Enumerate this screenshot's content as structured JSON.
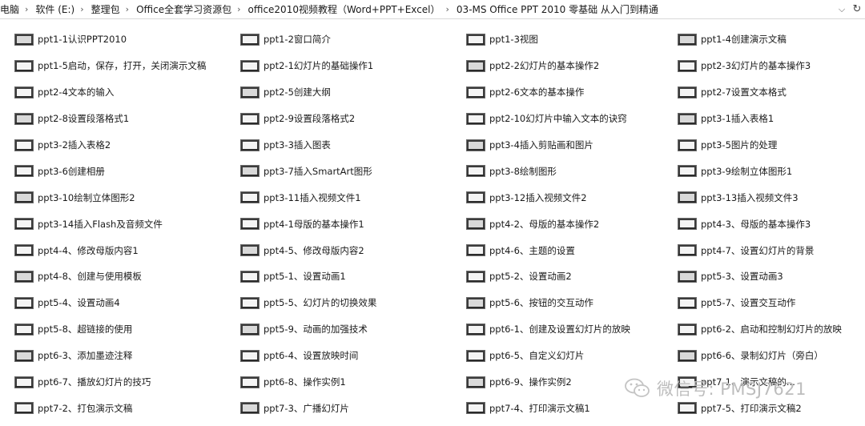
{
  "breadcrumb": [
    "电脑",
    "软件 (E:)",
    "整理包",
    "Office全套学习资源包",
    "office2010视频教程（Word+PPT+Excel）",
    "03-MS Office PPT 2010 零基础 从入门到精通"
  ],
  "separator": "›",
  "address_dropdown": "⌵",
  "refresh": "↻",
  "files": [
    {
      "name": "ppt1-1认识PPT2010"
    },
    {
      "name": "ppt1-2窗口简介"
    },
    {
      "name": "ppt1-3视图"
    },
    {
      "name": "ppt1-4创建演示文稿"
    },
    {
      "name": "ppt1-5启动，保存，打开，关闭演示文稿"
    },
    {
      "name": "ppt2-1幻灯片的基础操作1"
    },
    {
      "name": "ppt2-2幻灯片的基本操作2"
    },
    {
      "name": "ppt2-3幻灯片的基本操作3"
    },
    {
      "name": "ppt2-4文本的输入"
    },
    {
      "name": "ppt2-5创建大纲"
    },
    {
      "name": "ppt2-6文本的基本操作"
    },
    {
      "name": "ppt2-7设置文本格式"
    },
    {
      "name": "ppt2-8设置段落格式1"
    },
    {
      "name": "ppt2-9设置段落格式2"
    },
    {
      "name": "ppt2-10幻灯片中输入文本的诀窍"
    },
    {
      "name": "ppt3-1插入表格1"
    },
    {
      "name": "ppt3-2插入表格2"
    },
    {
      "name": "ppt3-3插入图表"
    },
    {
      "name": "ppt3-4插入剪贴画和图片"
    },
    {
      "name": "ppt3-5图片的处理"
    },
    {
      "name": "ppt3-6创建相册"
    },
    {
      "name": "ppt3-7插入SmartArt图形"
    },
    {
      "name": "ppt3-8绘制图形"
    },
    {
      "name": "ppt3-9绘制立体图形1"
    },
    {
      "name": "ppt3-10绘制立体图形2"
    },
    {
      "name": "ppt3-11插入视频文件1"
    },
    {
      "name": "ppt3-12插入视频文件2"
    },
    {
      "name": "ppt3-13插入视频文件3"
    },
    {
      "name": "ppt3-14插入Flash及音频文件"
    },
    {
      "name": "ppt4-1母版的基本操作1"
    },
    {
      "name": "ppt4-2、母版的基本操作2"
    },
    {
      "name": "ppt4-3、母版的基本操作3"
    },
    {
      "name": "ppt4-4、修改母版内容1"
    },
    {
      "name": "ppt4-5、修改母版内容2"
    },
    {
      "name": "ppt4-6、主题的设置"
    },
    {
      "name": "ppt4-7、设置幻灯片的背景"
    },
    {
      "name": "ppt4-8、创建与使用模板"
    },
    {
      "name": "ppt5-1、设置动画1"
    },
    {
      "name": "ppt5-2、设置动画2"
    },
    {
      "name": "ppt5-3、设置动画3"
    },
    {
      "name": "ppt5-4、设置动画4"
    },
    {
      "name": "ppt5-5、幻灯片的切换效果"
    },
    {
      "name": "ppt5-6、按钮的交互动作"
    },
    {
      "name": "ppt5-7、设置交互动作"
    },
    {
      "name": "ppt5-8、超链接的使用"
    },
    {
      "name": "ppt5-9、动画的加强技术"
    },
    {
      "name": "ppt6-1、创建及设置幻灯片的放映"
    },
    {
      "name": "ppt6-2、启动和控制幻灯片的放映"
    },
    {
      "name": "ppt6-3、添加墨迹注释"
    },
    {
      "name": "ppt6-4、设置放映时间"
    },
    {
      "name": "ppt6-5、自定义幻灯片"
    },
    {
      "name": "ppt6-6、录制幻灯片（旁白）"
    },
    {
      "name": "ppt6-7、播放幻灯片的技巧"
    },
    {
      "name": "ppt6-8、操作实例1"
    },
    {
      "name": "ppt6-9、操作实例2"
    },
    {
      "name": "ppt7-1、演示文稿的..."
    },
    {
      "name": "ppt7-2、打包演示文稿"
    },
    {
      "name": "ppt7-3、广播幻灯片"
    },
    {
      "name": "ppt7-4、打印演示文稿1"
    },
    {
      "name": "ppt7-5、打印演示文稿2"
    }
  ],
  "watermark": {
    "text": "微信号: PMSJ7621",
    "icon": "wechat-icon"
  },
  "colors": {
    "text": "#1a1a1a",
    "thumb_frame": "#3c3c3c",
    "watermark": "#bdbdbd"
  }
}
